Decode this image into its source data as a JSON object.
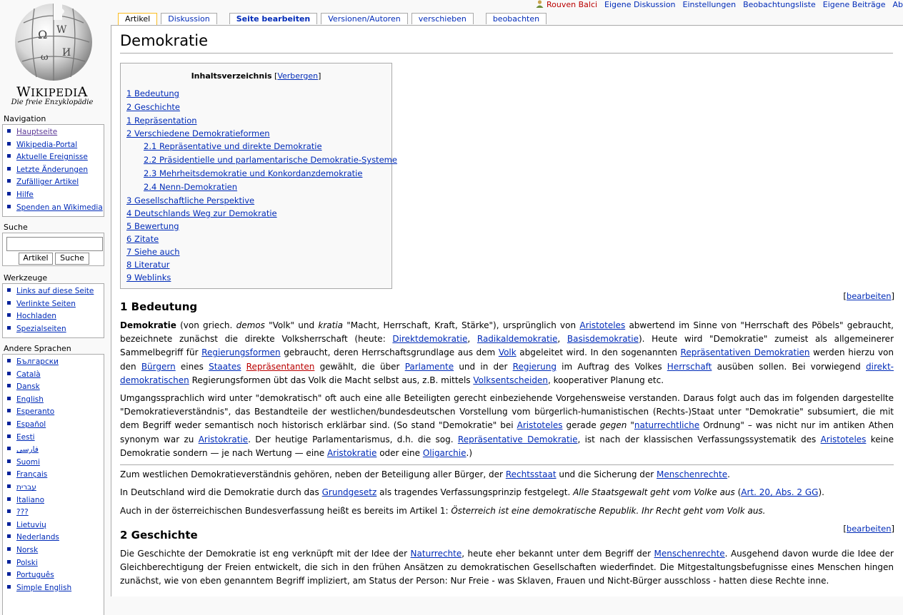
{
  "personal": {
    "user": "Rouven Balci",
    "talk": "Eigene Diskussion",
    "prefs": "Einstellungen",
    "watchlist": "Beobachtungsliste",
    "contribs": "Eigene Beiträge",
    "logout": "Abmelden"
  },
  "tabs": {
    "article": "Artikel",
    "discussion": "Diskussion",
    "edit": "Seite bearbeiten",
    "history": "Versionen/Autoren",
    "move": "verschieben",
    "watch": "beobachten"
  },
  "logo": {
    "title": "Wikipedia",
    "subtitle": "Die freie Enzyklopädie"
  },
  "navigation": {
    "heading": "Navigation",
    "items": [
      "Hauptseite",
      "Wikipedia-Portal",
      "Aktuelle Ereignisse",
      "Letzte Änderungen",
      "Zufälliger Artikel",
      "Hilfe",
      "Spenden an Wikimedia"
    ]
  },
  "search": {
    "heading": "Suche",
    "go": "Artikel",
    "search": "Suche",
    "value": ""
  },
  "toolbox": {
    "heading": "Werkzeuge",
    "items": [
      "Links auf diese Seite",
      "Verlinkte Seiten",
      "Hochladen",
      "Spezialseiten"
    ]
  },
  "languages": {
    "heading": "Andere Sprachen",
    "items": [
      "Български",
      "Català",
      "Dansk",
      "English",
      "Esperanto",
      "Español",
      "Eesti",
      "فارسی",
      "Suomi",
      "Français",
      "עברית",
      "Italiano",
      "???",
      "Lietuvių",
      "Nederlands",
      "Norsk",
      "Polski",
      "Português",
      "Simple English"
    ]
  },
  "article": {
    "title": "Demokratie",
    "toc": {
      "title": "Inhaltsverzeichnis",
      "toggle_open": "[",
      "toggle": "Verbergen",
      "toggle_close": "]",
      "entries": [
        "1 Bedeutung",
        "2 Geschichte",
        "1 Repräsentation",
        "2 Verschiedene Demokratieformen",
        "2.1 Repräsentative und direkte Demokratie",
        "2.2 Präsidentielle und parlamentarische Demokratie-Systeme",
        "2.3 Mehrheitsdemokratie und Konkordanzdemokratie",
        "2.4 Nenn-Demokratien",
        "3 Gesellschaftliche Perspektive",
        "4 Deutschlands Weg zur Demokratie",
        "5 Bewertung",
        "6 Zitate",
        "7 Siehe auch",
        "8 Literatur",
        "9 Weblinks"
      ]
    },
    "edit_open": "[",
    "edit_label": "bearbeiten",
    "edit_close": "]",
    "sections": {
      "s1": "1 Bedeutung",
      "s2": "2 Geschichte"
    },
    "p1": {
      "a": "Demokratie",
      "b": " (von griech. ",
      "c": "demos",
      "d": " \"Volk\" und ",
      "e": "kratia",
      "f": " \"Macht, Herrschaft, Kraft, Stärke\"), ursprünglich von ",
      "g": "Aristoteles",
      "h": " abwertend im Sinne von \"Herrschaft des Pöbels\" gebraucht, bezeichnete zunächst die direkte Volksherrschaft (heute: ",
      "i": "Direktdemokratie",
      "j": ", ",
      "k": "Radikaldemokratie",
      "l": ", ",
      "m": "Basisdemokratie",
      "n": "). Heute wird \"Demokratie\" zumeist als allgemeinerer Sammelbegriff für ",
      "o": "Regierungsformen",
      "p": " gebraucht, deren Herrschaftsgrundlage aus dem ",
      "q": "Volk",
      "r": " abgeleitet wird. In den sogenannten ",
      "s": "Repräsentativen Demokratien",
      "t": " werden hierzu von den ",
      "u": "Bürgern",
      "v": " eines ",
      "w": "Staates",
      "x": " ",
      "y": "Repräsentanten",
      "z": " gewählt, die über ",
      "aa": "Parlamente",
      "ab": " und in der ",
      "ac": "Regierung",
      "ad": " im Auftrag des Volkes ",
      "ae": "Herrschaft",
      "af": " ausüben sollen. Bei vorwiegend ",
      "ag": "direkt-demokratischen",
      "ah": " Regierungsformen übt das Volk die Macht selbst aus, z.B. mittels ",
      "ai": "Volksentscheiden",
      "aj": ", kooperativer Planung etc."
    },
    "p2": {
      "a": "Umgangssprachlich wird unter \"demokratisch\" oft auch eine alle Beteiligten gerecht einbeziehende Vorgehensweise verstanden. Daraus folgt auch das im folgenden dargestellte \"Demokratieverständnis\", das Bestandteile der westlichen/bundesdeutschen Vorstellung vom bürgerlich-humanistischen (Rechts-)Staat unter \"Demokratie\" subsumiert, die mit dem Begriff weder semantisch noch historisch erklärbar sind. (So stand \"Demokratie\" bei ",
      "b": "Aristoteles",
      "c": " gerade ",
      "d": "gegen",
      "e": " \"",
      "f": "naturrechtliche",
      "g": " Ordnung\" – was nicht nur im antiken Athen synonym war zu ",
      "h": "Aristokratie",
      "i": ". Der heutige Parlamentarismus, d.h. die sog. ",
      "j": "Repräsentative Demokratie",
      "k": ", ist nach der klassischen Verfassungssystematik des ",
      "l": "Aristoteles",
      "m": " keine Demokratie sondern — je nach Wertung — eine ",
      "n": "Aristokratie",
      "o": " oder eine ",
      "p": "Oligarchie",
      "q": ".)"
    },
    "p3": {
      "a": "Zum westlichen Demokratieverständnis gehören, neben der Beteiligung aller Bürger, der ",
      "b": "Rechtsstaat",
      "c": " und die Sicherung der ",
      "d": "Menschenrechte",
      "e": "."
    },
    "p4": {
      "a": "In Deutschland wird die Demokratie durch das ",
      "b": "Grundgesetz",
      "c": " als tragendes Verfassungsprinzip festgelegt. ",
      "d": "Alle Staatsgewalt geht vom Volke aus",
      "e": " (",
      "f": "Art. 20, Abs. 2 GG",
      "g": ")."
    },
    "p5": {
      "a": "Auch in der österreichischen Bundesverfassung heißt es bereits im Artikel 1: ",
      "b": "Österreich ist eine demokratische Republik. Ihr Recht geht vom Volk aus."
    },
    "p6": {
      "a": "Die Geschichte der Demokratie ist eng verknüpft mit der Idee der ",
      "b": "Naturrechte",
      "c": ", heute eher bekannt unter dem Begriff der ",
      "d": "Menschenrechte",
      "e": ". Ausgehend davon wurde die Idee der Gleichberechtigung der Freien entwickelt, die sich in den frühen Ansätzen zu demokratischen Gesellschaften wiederfindet. Die Mitgestaltungsbefugnisse eines Menschen hingen zunächst, wie von eben genanntem Begriff impliziert, am Status der Person: Nur Freie - was Sklaven, Frauen und Nicht-Bürger ausschloss - hatten diese Rechte inne."
    }
  },
  "colors": {
    "link": "#002bb8",
    "newlink": "#ba0000",
    "tab_active": "#fabd23",
    "bullet": "#00219a"
  }
}
